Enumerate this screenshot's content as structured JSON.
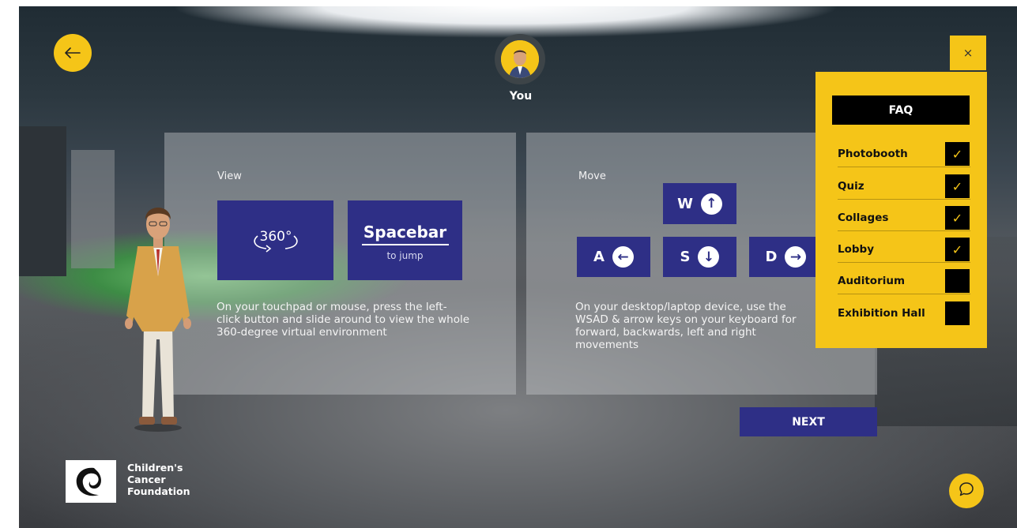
{
  "header": {
    "user_label": "You"
  },
  "icons": {
    "back": "arrow-left-icon",
    "close": "close-icon",
    "chat": "chat-bubble-icon",
    "avatar": "user-avatar-icon",
    "view_360": "rotate-360-icon"
  },
  "view_panel": {
    "title": "View",
    "tile_360_label": "360°",
    "spacebar_title": "Spacebar",
    "spacebar_sub": "to jump",
    "description": "On your touchpad or mouse, press the left-click button and slide around to view the whole 360-degree virtual environment"
  },
  "move_panel": {
    "title": "Move",
    "keys": [
      {
        "letter": "W",
        "arrow": "↑",
        "icon": "arrow-up-icon"
      },
      {
        "letter": "A",
        "arrow": "←",
        "icon": "arrow-left-icon"
      },
      {
        "letter": "S",
        "arrow": "↓",
        "icon": "arrow-down-icon"
      },
      {
        "letter": "D",
        "arrow": "→",
        "icon": "arrow-right-icon"
      }
    ],
    "description": "On your desktop/laptop device, use the WSAD & arrow keys on your keyboard for forward, backwards, left and right movements"
  },
  "next_label": "NEXT",
  "close_label": "×",
  "faq": {
    "header": "FAQ",
    "items": [
      {
        "label": "Photobooth",
        "checked": true,
        "mark": "✓"
      },
      {
        "label": "Quiz",
        "checked": true,
        "mark": "✓"
      },
      {
        "label": "Collages",
        "checked": true,
        "mark": "✓"
      },
      {
        "label": "Lobby",
        "checked": true,
        "mark": "✓"
      },
      {
        "label": "Auditorium",
        "checked": false,
        "mark": ""
      },
      {
        "label": "Exhibition Hall",
        "checked": false,
        "mark": ""
      }
    ]
  },
  "logo": {
    "line1": "Children's",
    "line2": "Cancer",
    "line3": "Foundation"
  },
  "colors": {
    "accent_yellow": "#f5c518",
    "navy": "#2e2f86",
    "black": "#000000"
  }
}
